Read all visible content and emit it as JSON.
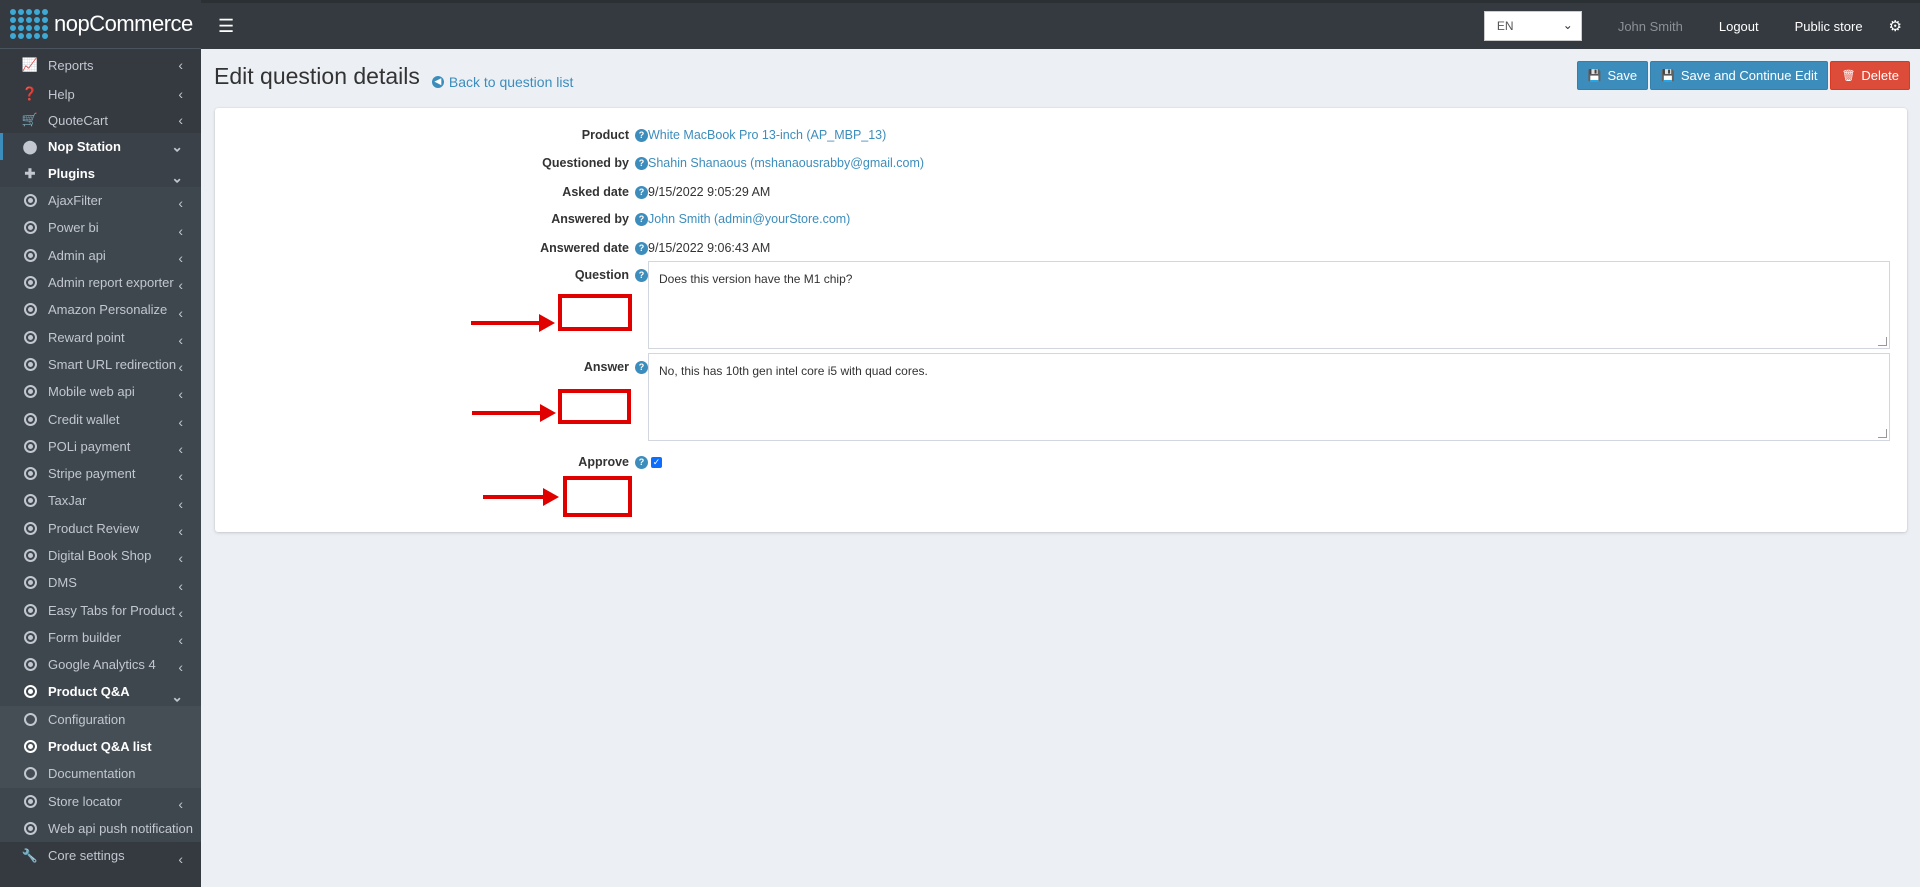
{
  "brand": {
    "name": "nopCommerce"
  },
  "sidebar": {
    "top_items": [
      {
        "label": "Reports",
        "icon": "chart-icon"
      },
      {
        "label": "Help",
        "icon": "question-circle-icon"
      },
      {
        "label": "QuoteCart",
        "icon": "cart-icon"
      },
      {
        "label": "Nop Station",
        "icon": "circle-icon"
      }
    ],
    "plugins_label": "Plugins",
    "plugin_items": [
      "AjaxFilter",
      "Power bi",
      "Admin api",
      "Admin report exporter",
      "Amazon Personalize",
      "Reward point",
      "Smart URL redirection",
      "Mobile web api",
      "Credit wallet",
      "POLi payment",
      "Stripe payment",
      "TaxJar",
      "Product Review",
      "Digital Book Shop",
      "DMS",
      "Easy Tabs for Product",
      "Form builder",
      "Google Analytics 4"
    ],
    "qa_label": "Product Q&A",
    "qa_items": [
      "Configuration",
      "Product Q&A list",
      "Documentation"
    ],
    "after_items": [
      "Store locator",
      "Web api push notification"
    ],
    "core_settings": "Core settings"
  },
  "topbar": {
    "language": "EN",
    "user": "John Smith",
    "logout": "Logout",
    "public_store": "Public store"
  },
  "page": {
    "title": "Edit question details",
    "back_link": "Back to question list"
  },
  "actions": {
    "save": "Save",
    "save_continue": "Save and Continue Edit",
    "delete": "Delete"
  },
  "form": {
    "product_label": "Product",
    "product_value": "White MacBook Pro 13-inch (AP_MBP_13)",
    "questioned_by_label": "Questioned by",
    "questioned_by_value": "Shahin Shanaous (mshanaousrabby@gmail.com)",
    "asked_date_label": "Asked date",
    "asked_date_value": "9/15/2022 9:05:29 AM",
    "answered_by_label": "Answered by",
    "answered_by_value": "John Smith (admin@yourStore.com)",
    "answered_date_label": "Answered date",
    "answered_date_value": "9/15/2022 9:06:43 AM",
    "question_label": "Question",
    "question_value": "Does this version have the M1 chip?",
    "answer_label": "Answer",
    "answer_value": "No, this has 10th gen intel core i5 with quad cores.",
    "approve_label": "Approve",
    "approve_checked": true
  },
  "colors": {
    "accent": "#3c8dbc",
    "danger": "#dd4b39",
    "highlight": "#e00000",
    "sidebar_bg": "#343a40"
  }
}
